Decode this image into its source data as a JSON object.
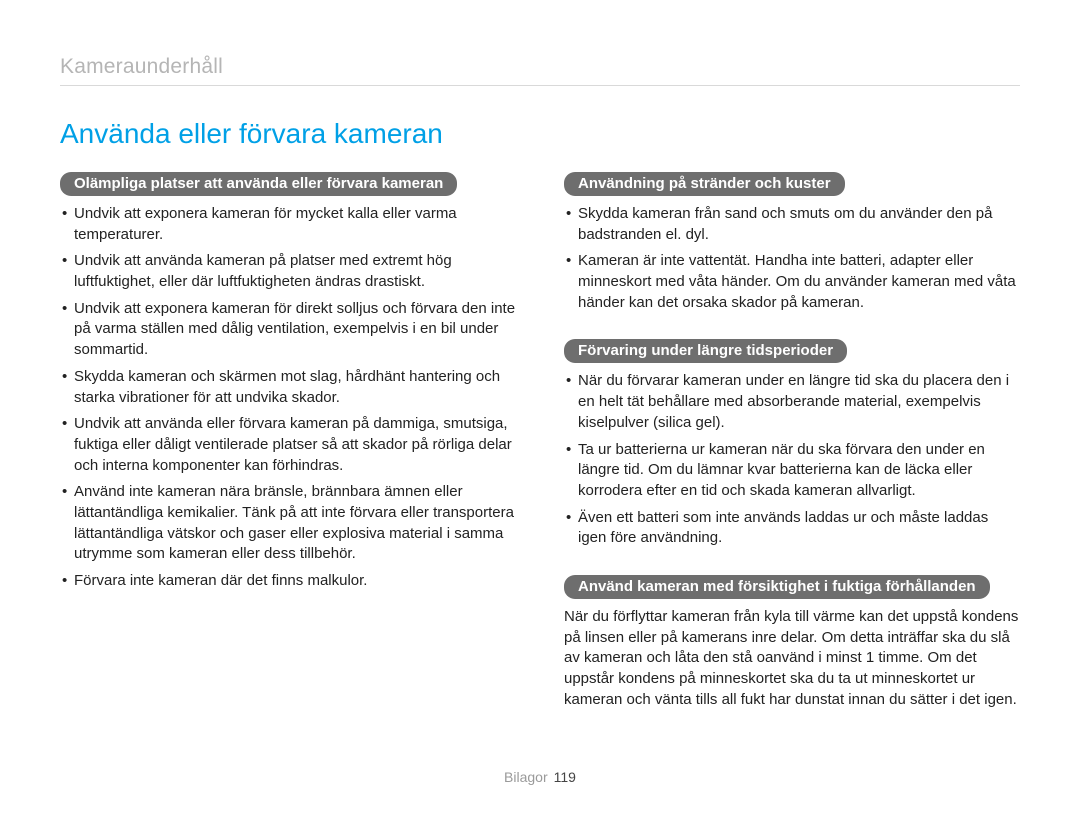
{
  "breadcrumb": "Kameraunderhåll",
  "title": "Använda eller förvara kameran",
  "footer": {
    "label": "Bilagor",
    "page": "119"
  },
  "left": {
    "section1": {
      "heading": "Olämpliga platser att använda eller förvara kameran",
      "items": [
        "Undvik att exponera kameran för mycket kalla eller varma temperaturer.",
        "Undvik att använda kameran på platser med extremt hög luftfuktighet, eller där luftfuktigheten ändras drastiskt.",
        "Undvik att exponera kameran för direkt solljus och förvara den inte på varma ställen med dålig ventilation, exempelvis i en bil under sommartid.",
        "Skydda kameran och skärmen mot slag, hårdhänt hantering och starka vibrationer för att undvika skador.",
        "Undvik att använda eller förvara kameran på dammiga, smutsiga, fuktiga eller dåligt ventilerade platser så att skador på rörliga delar och interna komponenter kan förhindras.",
        "Använd inte kameran nära bränsle, brännbara ämnen eller lättantändliga kemikalier. Tänk på att inte förvara eller transportera lättantändliga vätskor och gaser eller explosiva material i samma utrymme som kameran eller dess tillbehör.",
        "Förvara inte kameran där det finns malkulor."
      ]
    }
  },
  "right": {
    "section1": {
      "heading": "Användning på stränder och kuster",
      "items": [
        "Skydda kameran från sand och smuts om du använder den på badstranden el. dyl.",
        "Kameran är inte vattentät. Handha inte batteri, adapter eller minneskort med våta händer. Om du använder kameran med våta händer kan det orsaka skador på kameran."
      ]
    },
    "section2": {
      "heading": "Förvaring under längre tidsperioder",
      "items": [
        "När du förvarar kameran under en längre tid ska du placera den i en helt tät behållare med absorberande material, exempelvis kiselpulver (silica gel).",
        "Ta ur batterierna ur kameran när du ska förvara den under en längre tid. Om du lämnar kvar batterierna kan de läcka eller korrodera efter en tid och skada kameran allvarligt.",
        "Även ett batteri som inte används laddas ur och måste laddas igen före användning."
      ]
    },
    "section3": {
      "heading": "Använd kameran med försiktighet i fuktiga förhållanden",
      "body": "När du förflyttar kameran från kyla till värme kan det uppstå kondens på linsen eller på kamerans inre delar. Om detta inträffar ska du slå av kameran och låta den stå oanvänd i minst 1 timme. Om det uppstår kondens på minneskortet ska du ta ut minneskortet ur kameran och vänta tills all fukt har dunstat innan du sätter i det igen."
    }
  }
}
